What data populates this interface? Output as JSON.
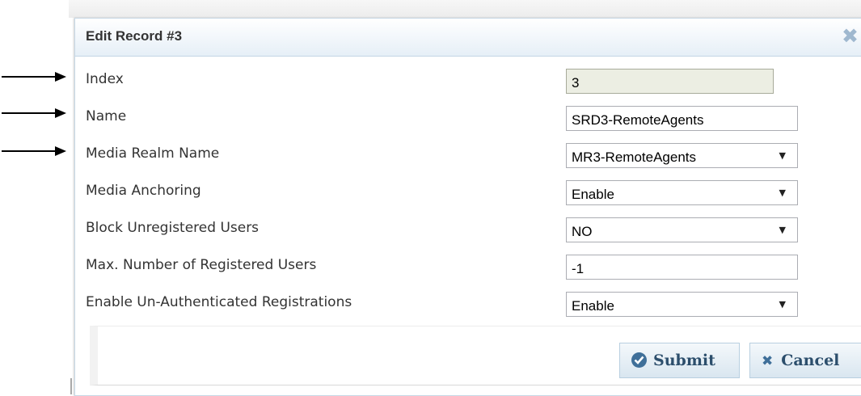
{
  "dialog": {
    "title": "Edit Record #3",
    "close_icon": "close-icon"
  },
  "fields": [
    {
      "label": "Index",
      "type": "readonly",
      "value": "3"
    },
    {
      "label": "Name",
      "type": "text",
      "value": "SRD3-RemoteAgents"
    },
    {
      "label": "Media Realm Name",
      "type": "select",
      "value": "MR3-RemoteAgents"
    },
    {
      "label": "Media Anchoring",
      "type": "select",
      "value": "Enable"
    },
    {
      "label": "Block Unregistered Users",
      "type": "select",
      "value": "NO"
    },
    {
      "label": "Max. Number of Registered Users",
      "type": "text",
      "value": "-1"
    },
    {
      "label": "Enable Un-Authenticated Registrations",
      "type": "select",
      "value": "Enable"
    }
  ],
  "buttons": {
    "submit_label": "Submit",
    "cancel_label": "Cancel"
  },
  "annotations": {
    "arrow_icon": "right-arrow-icon"
  },
  "colors": {
    "title_gradient_end": "#e6eff7",
    "button_text": "#2c4e6c",
    "close_icon": "#9fb8cf"
  }
}
